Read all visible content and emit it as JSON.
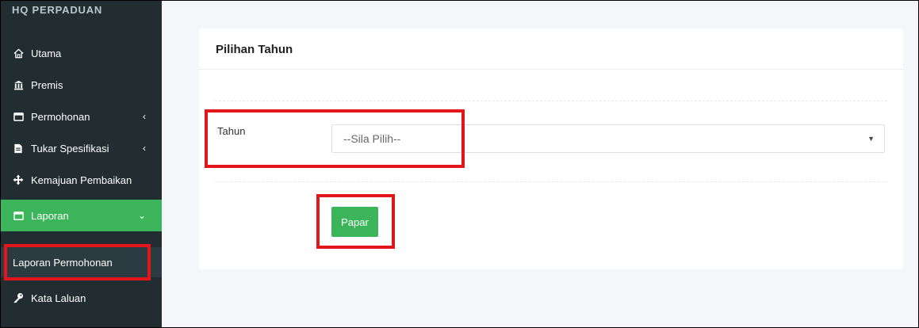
{
  "sidebar": {
    "brand": "HQ PERPADUAN",
    "items": [
      {
        "label": "Utama",
        "icon": "home-icon"
      },
      {
        "label": "Premis",
        "icon": "bank-icon"
      },
      {
        "label": "Permohonan",
        "icon": "copy-icon",
        "chevron": "‹"
      },
      {
        "label": "Tukar Spesifikasi",
        "icon": "file-icon",
        "chevron": "‹"
      },
      {
        "label": "Kemajuan Pembaikan",
        "icon": "arrows-icon"
      },
      {
        "label": "Laporan",
        "icon": "copy-icon",
        "chevron": "⌄",
        "active": true
      },
      {
        "label": "Kata Laluan",
        "icon": "key-icon"
      }
    ],
    "submenu": {
      "label": "Laporan Permohonan"
    }
  },
  "card": {
    "title": "Pilihan Tahun",
    "field_label": "Tahun",
    "select_value": "--Sila Pilih--",
    "button_label": "Papar"
  },
  "colors": {
    "sidebar_bg": "#222d32",
    "accent_green": "#3cb55a",
    "highlight_red": "#e3161b"
  }
}
